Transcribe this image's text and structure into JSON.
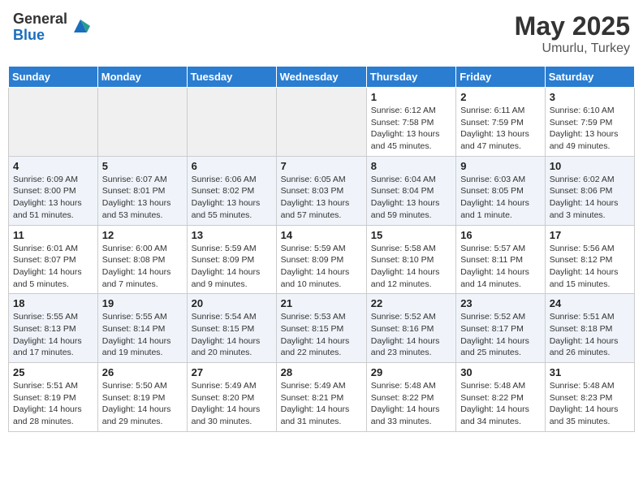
{
  "header": {
    "logo_general": "General",
    "logo_blue": "Blue",
    "month_year": "May 2025",
    "location": "Umurlu, Turkey"
  },
  "days_of_week": [
    "Sunday",
    "Monday",
    "Tuesday",
    "Wednesday",
    "Thursday",
    "Friday",
    "Saturday"
  ],
  "weeks": [
    [
      {
        "day": "",
        "empty": true
      },
      {
        "day": "",
        "empty": true
      },
      {
        "day": "",
        "empty": true
      },
      {
        "day": "",
        "empty": true
      },
      {
        "day": "1",
        "sunrise": "6:12 AM",
        "sunset": "7:58 PM",
        "daylight": "13 hours and 45 minutes."
      },
      {
        "day": "2",
        "sunrise": "6:11 AM",
        "sunset": "7:59 PM",
        "daylight": "13 hours and 47 minutes."
      },
      {
        "day": "3",
        "sunrise": "6:10 AM",
        "sunset": "7:59 PM",
        "daylight": "13 hours and 49 minutes."
      }
    ],
    [
      {
        "day": "4",
        "sunrise": "6:09 AM",
        "sunset": "8:00 PM",
        "daylight": "13 hours and 51 minutes."
      },
      {
        "day": "5",
        "sunrise": "6:07 AM",
        "sunset": "8:01 PM",
        "daylight": "13 hours and 53 minutes."
      },
      {
        "day": "6",
        "sunrise": "6:06 AM",
        "sunset": "8:02 PM",
        "daylight": "13 hours and 55 minutes."
      },
      {
        "day": "7",
        "sunrise": "6:05 AM",
        "sunset": "8:03 PM",
        "daylight": "13 hours and 57 minutes."
      },
      {
        "day": "8",
        "sunrise": "6:04 AM",
        "sunset": "8:04 PM",
        "daylight": "13 hours and 59 minutes."
      },
      {
        "day": "9",
        "sunrise": "6:03 AM",
        "sunset": "8:05 PM",
        "daylight": "14 hours and 1 minute."
      },
      {
        "day": "10",
        "sunrise": "6:02 AM",
        "sunset": "8:06 PM",
        "daylight": "14 hours and 3 minutes."
      }
    ],
    [
      {
        "day": "11",
        "sunrise": "6:01 AM",
        "sunset": "8:07 PM",
        "daylight": "14 hours and 5 minutes."
      },
      {
        "day": "12",
        "sunrise": "6:00 AM",
        "sunset": "8:08 PM",
        "daylight": "14 hours and 7 minutes."
      },
      {
        "day": "13",
        "sunrise": "5:59 AM",
        "sunset": "8:09 PM",
        "daylight": "14 hours and 9 minutes."
      },
      {
        "day": "14",
        "sunrise": "5:59 AM",
        "sunset": "8:09 PM",
        "daylight": "14 hours and 10 minutes."
      },
      {
        "day": "15",
        "sunrise": "5:58 AM",
        "sunset": "8:10 PM",
        "daylight": "14 hours and 12 minutes."
      },
      {
        "day": "16",
        "sunrise": "5:57 AM",
        "sunset": "8:11 PM",
        "daylight": "14 hours and 14 minutes."
      },
      {
        "day": "17",
        "sunrise": "5:56 AM",
        "sunset": "8:12 PM",
        "daylight": "14 hours and 15 minutes."
      }
    ],
    [
      {
        "day": "18",
        "sunrise": "5:55 AM",
        "sunset": "8:13 PM",
        "daylight": "14 hours and 17 minutes."
      },
      {
        "day": "19",
        "sunrise": "5:55 AM",
        "sunset": "8:14 PM",
        "daylight": "14 hours and 19 minutes."
      },
      {
        "day": "20",
        "sunrise": "5:54 AM",
        "sunset": "8:15 PM",
        "daylight": "14 hours and 20 minutes."
      },
      {
        "day": "21",
        "sunrise": "5:53 AM",
        "sunset": "8:15 PM",
        "daylight": "14 hours and 22 minutes."
      },
      {
        "day": "22",
        "sunrise": "5:52 AM",
        "sunset": "8:16 PM",
        "daylight": "14 hours and 23 minutes."
      },
      {
        "day": "23",
        "sunrise": "5:52 AM",
        "sunset": "8:17 PM",
        "daylight": "14 hours and 25 minutes."
      },
      {
        "day": "24",
        "sunrise": "5:51 AM",
        "sunset": "8:18 PM",
        "daylight": "14 hours and 26 minutes."
      }
    ],
    [
      {
        "day": "25",
        "sunrise": "5:51 AM",
        "sunset": "8:19 PM",
        "daylight": "14 hours and 28 minutes."
      },
      {
        "day": "26",
        "sunrise": "5:50 AM",
        "sunset": "8:19 PM",
        "daylight": "14 hours and 29 minutes."
      },
      {
        "day": "27",
        "sunrise": "5:49 AM",
        "sunset": "8:20 PM",
        "daylight": "14 hours and 30 minutes."
      },
      {
        "day": "28",
        "sunrise": "5:49 AM",
        "sunset": "8:21 PM",
        "daylight": "14 hours and 31 minutes."
      },
      {
        "day": "29",
        "sunrise": "5:48 AM",
        "sunset": "8:22 PM",
        "daylight": "14 hours and 33 minutes."
      },
      {
        "day": "30",
        "sunrise": "5:48 AM",
        "sunset": "8:22 PM",
        "daylight": "14 hours and 34 minutes."
      },
      {
        "day": "31",
        "sunrise": "5:48 AM",
        "sunset": "8:23 PM",
        "daylight": "14 hours and 35 minutes."
      }
    ]
  ],
  "labels": {
    "sunrise": "Sunrise:",
    "sunset": "Sunset:",
    "daylight": "Daylight:"
  }
}
